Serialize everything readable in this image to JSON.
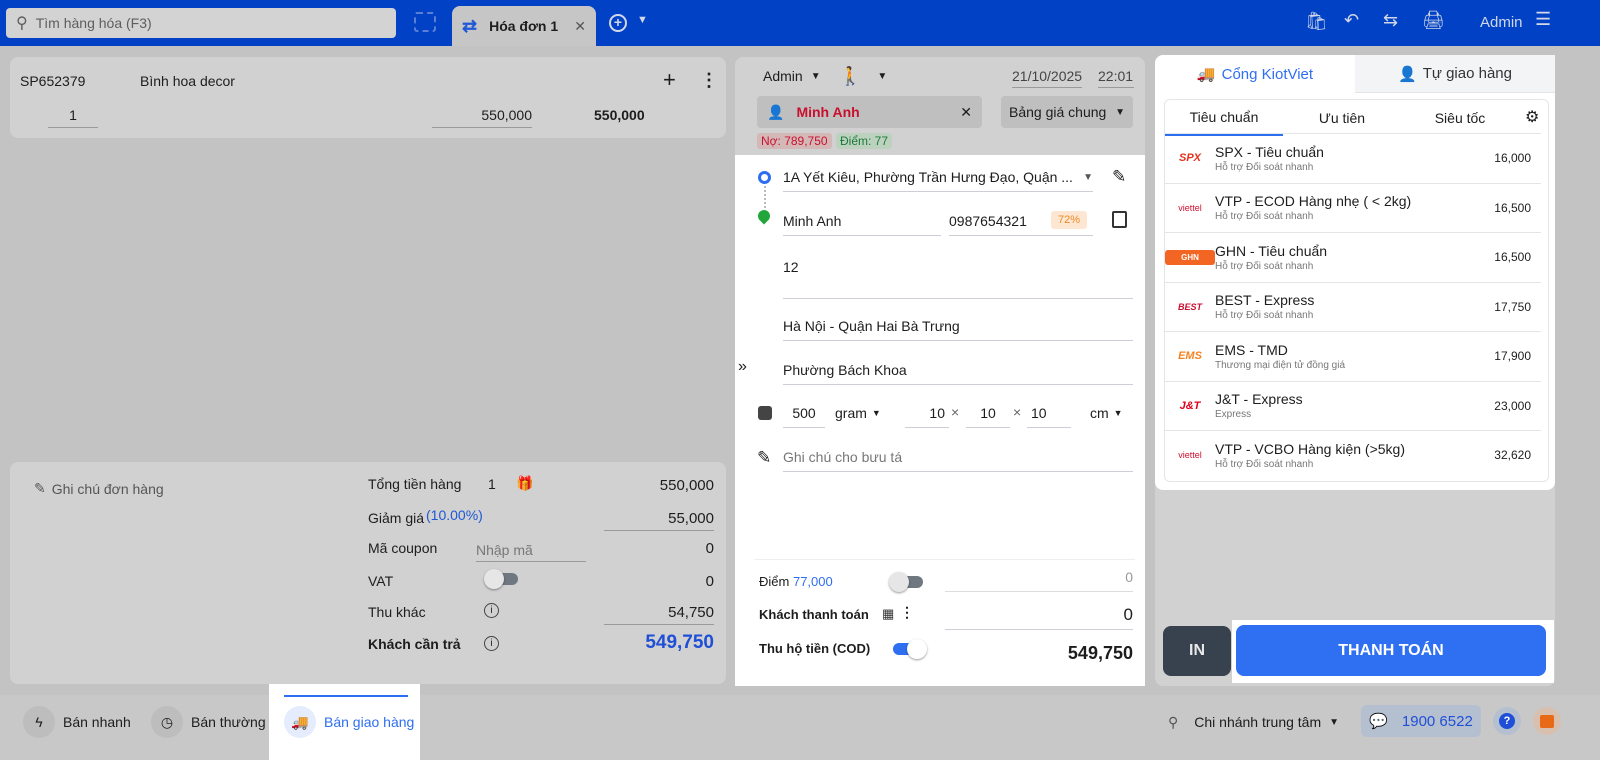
{
  "header": {
    "search_placeholder": "Tìm hàng hóa (F3)",
    "tab_label": "Hóa đơn 1",
    "user": "Admin"
  },
  "cart": {
    "items": [
      {
        "code": "SP652379",
        "name": "Bình hoa decor",
        "qty": "1",
        "price": "550,000",
        "total": "550,000"
      }
    ]
  },
  "summary": {
    "note_label": "Ghi chú đơn hàng",
    "subtotal_label": "Tổng tiền hàng",
    "subtotal_count": "1",
    "subtotal": "550,000",
    "discount_label": "Giảm giá",
    "discount_pct": "(10.00%)",
    "discount": "55,000",
    "coupon_label": "Mã coupon",
    "coupon_placeholder": "Nhập mã",
    "coupon": "0",
    "vat_label": "VAT",
    "vat": "0",
    "other_label": "Thu khác",
    "other": "54,750",
    "due_label": "Khách cần trả",
    "due": "549,750"
  },
  "order": {
    "seller": "Admin",
    "date": "21/10/2025",
    "time": "22:01",
    "customer": "Minh Anh",
    "price_list": "Bảng giá chung",
    "debt": "Nợ: 789,750",
    "points": "Điểm: 77"
  },
  "shipping": {
    "pickup_address": "1A Yết Kiêu, Phường Trần Hưng Đạo, Quận ...",
    "receiver_name": "Minh Anh",
    "receiver_phone": "0987654321",
    "success_rate": "72%",
    "address_line": "12",
    "district": "Hà Nội - Quận Hai Bà Trưng",
    "ward": "Phường Bách Khoa",
    "weight": "500",
    "weight_unit": "gram",
    "length": "10",
    "width": "10",
    "height": "10",
    "dim_unit": "cm",
    "times": "×",
    "note_placeholder": "Ghi chú cho bưu tá"
  },
  "payment": {
    "points_label": "Điểm",
    "points_value": "77,000",
    "points_amount": "0",
    "customer_pay_label": "Khách thanh toán",
    "customer_pay": "0",
    "cod_label": "Thu hộ tiền (COD)",
    "cod": "549,750"
  },
  "delivery": {
    "tabs": [
      "Cổng KiotViet",
      "Tự giao hàng"
    ],
    "service_tabs": [
      "Tiêu chuẩn",
      "Ưu tiên",
      "Siêu tốc"
    ],
    "carriers": [
      {
        "logo": "SPX",
        "name": "SPX - Tiêu chuẩn",
        "sub": "Hỗ trợ Đối soát nhanh",
        "price": "16,000"
      },
      {
        "logo": "viettel",
        "name": "VTP - ECOD Hàng nhẹ ( < 2kg)",
        "sub": "Hỗ trợ Đối soát nhanh",
        "price": "16,500"
      },
      {
        "logo": "GHN",
        "name": "GHN - Tiêu chuẩn",
        "sub": "Hỗ trợ Đối soát nhanh",
        "price": "16,500"
      },
      {
        "logo": "BEST",
        "name": "BEST - Express",
        "sub": "Hỗ trợ Đối soát nhanh",
        "price": "17,750"
      },
      {
        "logo": "EMS",
        "name": "EMS - TMD",
        "sub": "Thương mại điện tử đồng giá",
        "price": "17,900"
      },
      {
        "logo": "J&T",
        "name": "J&T - Express",
        "sub": "Express",
        "price": "23,000"
      },
      {
        "logo": "viettel",
        "name": "VTP - VCBO Hàng kiện (>5kg)",
        "sub": "Hỗ trợ Đối soát nhanh",
        "price": "32,620"
      }
    ]
  },
  "actions": {
    "print": "IN",
    "pay": "THANH TOÁN"
  },
  "footer": {
    "modes": [
      "Bán nhanh",
      "Bán thường",
      "Bán giao hàng"
    ],
    "branch": "Chi nhánh trung tâm",
    "hotline": "1900 6522"
  },
  "colors": {
    "brand": "#0141c6",
    "accent": "#2e6ff2"
  }
}
